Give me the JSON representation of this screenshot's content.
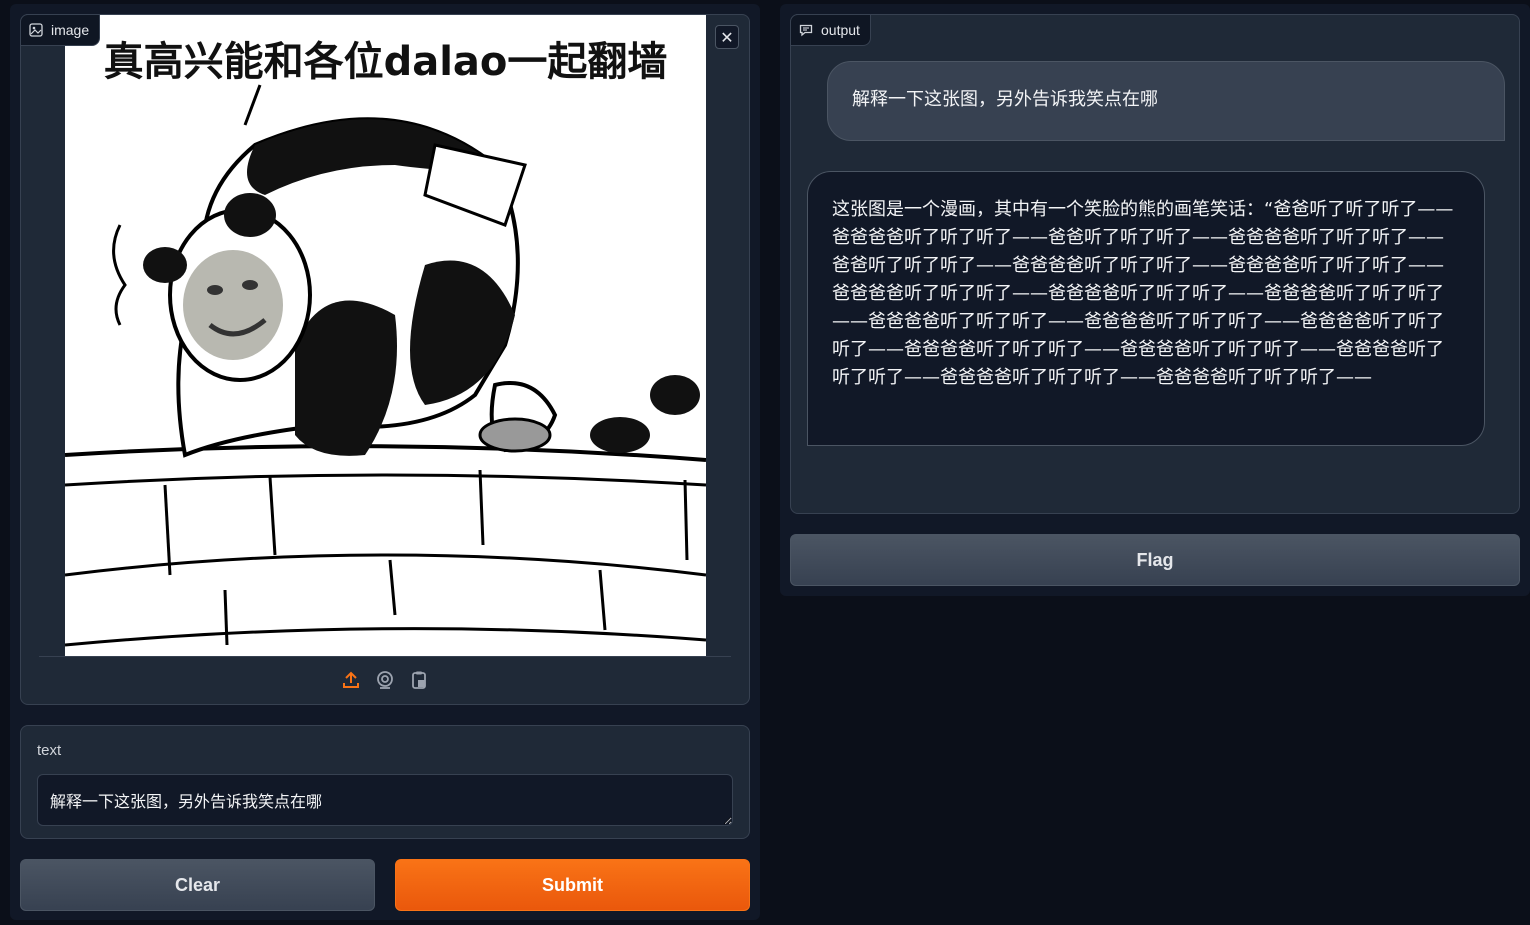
{
  "image_panel": {
    "label": "image",
    "label_icon": "image-icon",
    "caption_text": "真高兴能和各位dalao一起翻墙",
    "close_icon": "close-icon",
    "sources": [
      "upload-icon",
      "webcam-icon",
      "clipboard-icon"
    ],
    "accent_color": "#f97316"
  },
  "text_panel": {
    "label": "text",
    "value": "解释一下这张图，另外告诉我笑点在哪"
  },
  "buttons": {
    "clear": "Clear",
    "submit": "Submit",
    "flag": "Flag"
  },
  "output": {
    "label": "output",
    "label_icon": "chat-icon",
    "user_message": "解释一下这张图，另外告诉我笑点在哪",
    "bot_message": "这张图是一个漫画，其中有一个笑脸的熊的画笔笑话：“爸爸听了听了听了——爸爸爸爸听了听了听了——爸爸听了听了听了——爸爸爸爸听了听了听了——爸爸听了听了听了——爸爸爸爸听了听了听了——爸爸爸爸听了听了听了——爸爸爸爸听了听了听了——爸爸爸爸听了听了听了——爸爸爸爸听了听了听了——爸爸爸爸听了听了听了——爸爸爸爸听了听了听了——爸爸爸爸听了听了听了——爸爸爸爸听了听了听了——爸爸爸爸听了听了听了——爸爸爸爸听了听了听了——爸爸爸爸听了听了听了——爸爸爸爸听了听了听了——"
  }
}
